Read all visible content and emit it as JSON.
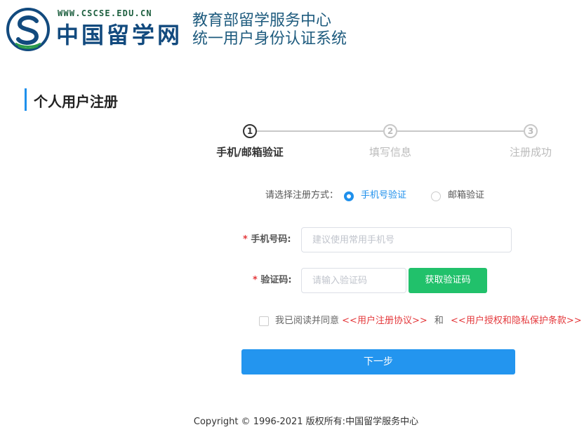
{
  "header": {
    "logo_url_text": "WWW.CSCSE.EDU.CN",
    "logo_name": "中国留学网",
    "system_title_line1": "教育部留学服务中心",
    "system_title_line2": "统一用户身份认证系统"
  },
  "page": {
    "heading": "个人用户注册"
  },
  "steps": [
    {
      "number": "1",
      "label": "手机/邮箱验证",
      "state": "active"
    },
    {
      "number": "2",
      "label": "填写信息",
      "state": "todo"
    },
    {
      "number": "3",
      "label": "注册成功",
      "state": "todo"
    }
  ],
  "registration_method": {
    "label": "请选择注册方式：",
    "options": [
      {
        "label": "手机号验证",
        "selected": true
      },
      {
        "label": "邮箱验证",
        "selected": false
      }
    ]
  },
  "form": {
    "phone": {
      "required_mark": "*",
      "label": "手机号码:",
      "placeholder": "建议使用常用手机号",
      "value": ""
    },
    "code": {
      "required_mark": "*",
      "label": "验证码:",
      "placeholder": "请输入验证码",
      "value": ""
    },
    "get_code_button": "获取验证码"
  },
  "agreement": {
    "checked": false,
    "prefix": "我已阅读并同意",
    "link1": "<<用户注册协议>>",
    "conjunction": "和",
    "link2": "<<用户授权和隐私保护条款>>"
  },
  "next_button": "下一步",
  "footer": {
    "copyright": "Copyright © 1996-2021 版权所有:中国留学服务中心"
  },
  "colors": {
    "primary_blue": "#2395ef",
    "green_button": "#21c16b",
    "required_red": "#e4393c",
    "title_blue": "#1e5b7e"
  }
}
